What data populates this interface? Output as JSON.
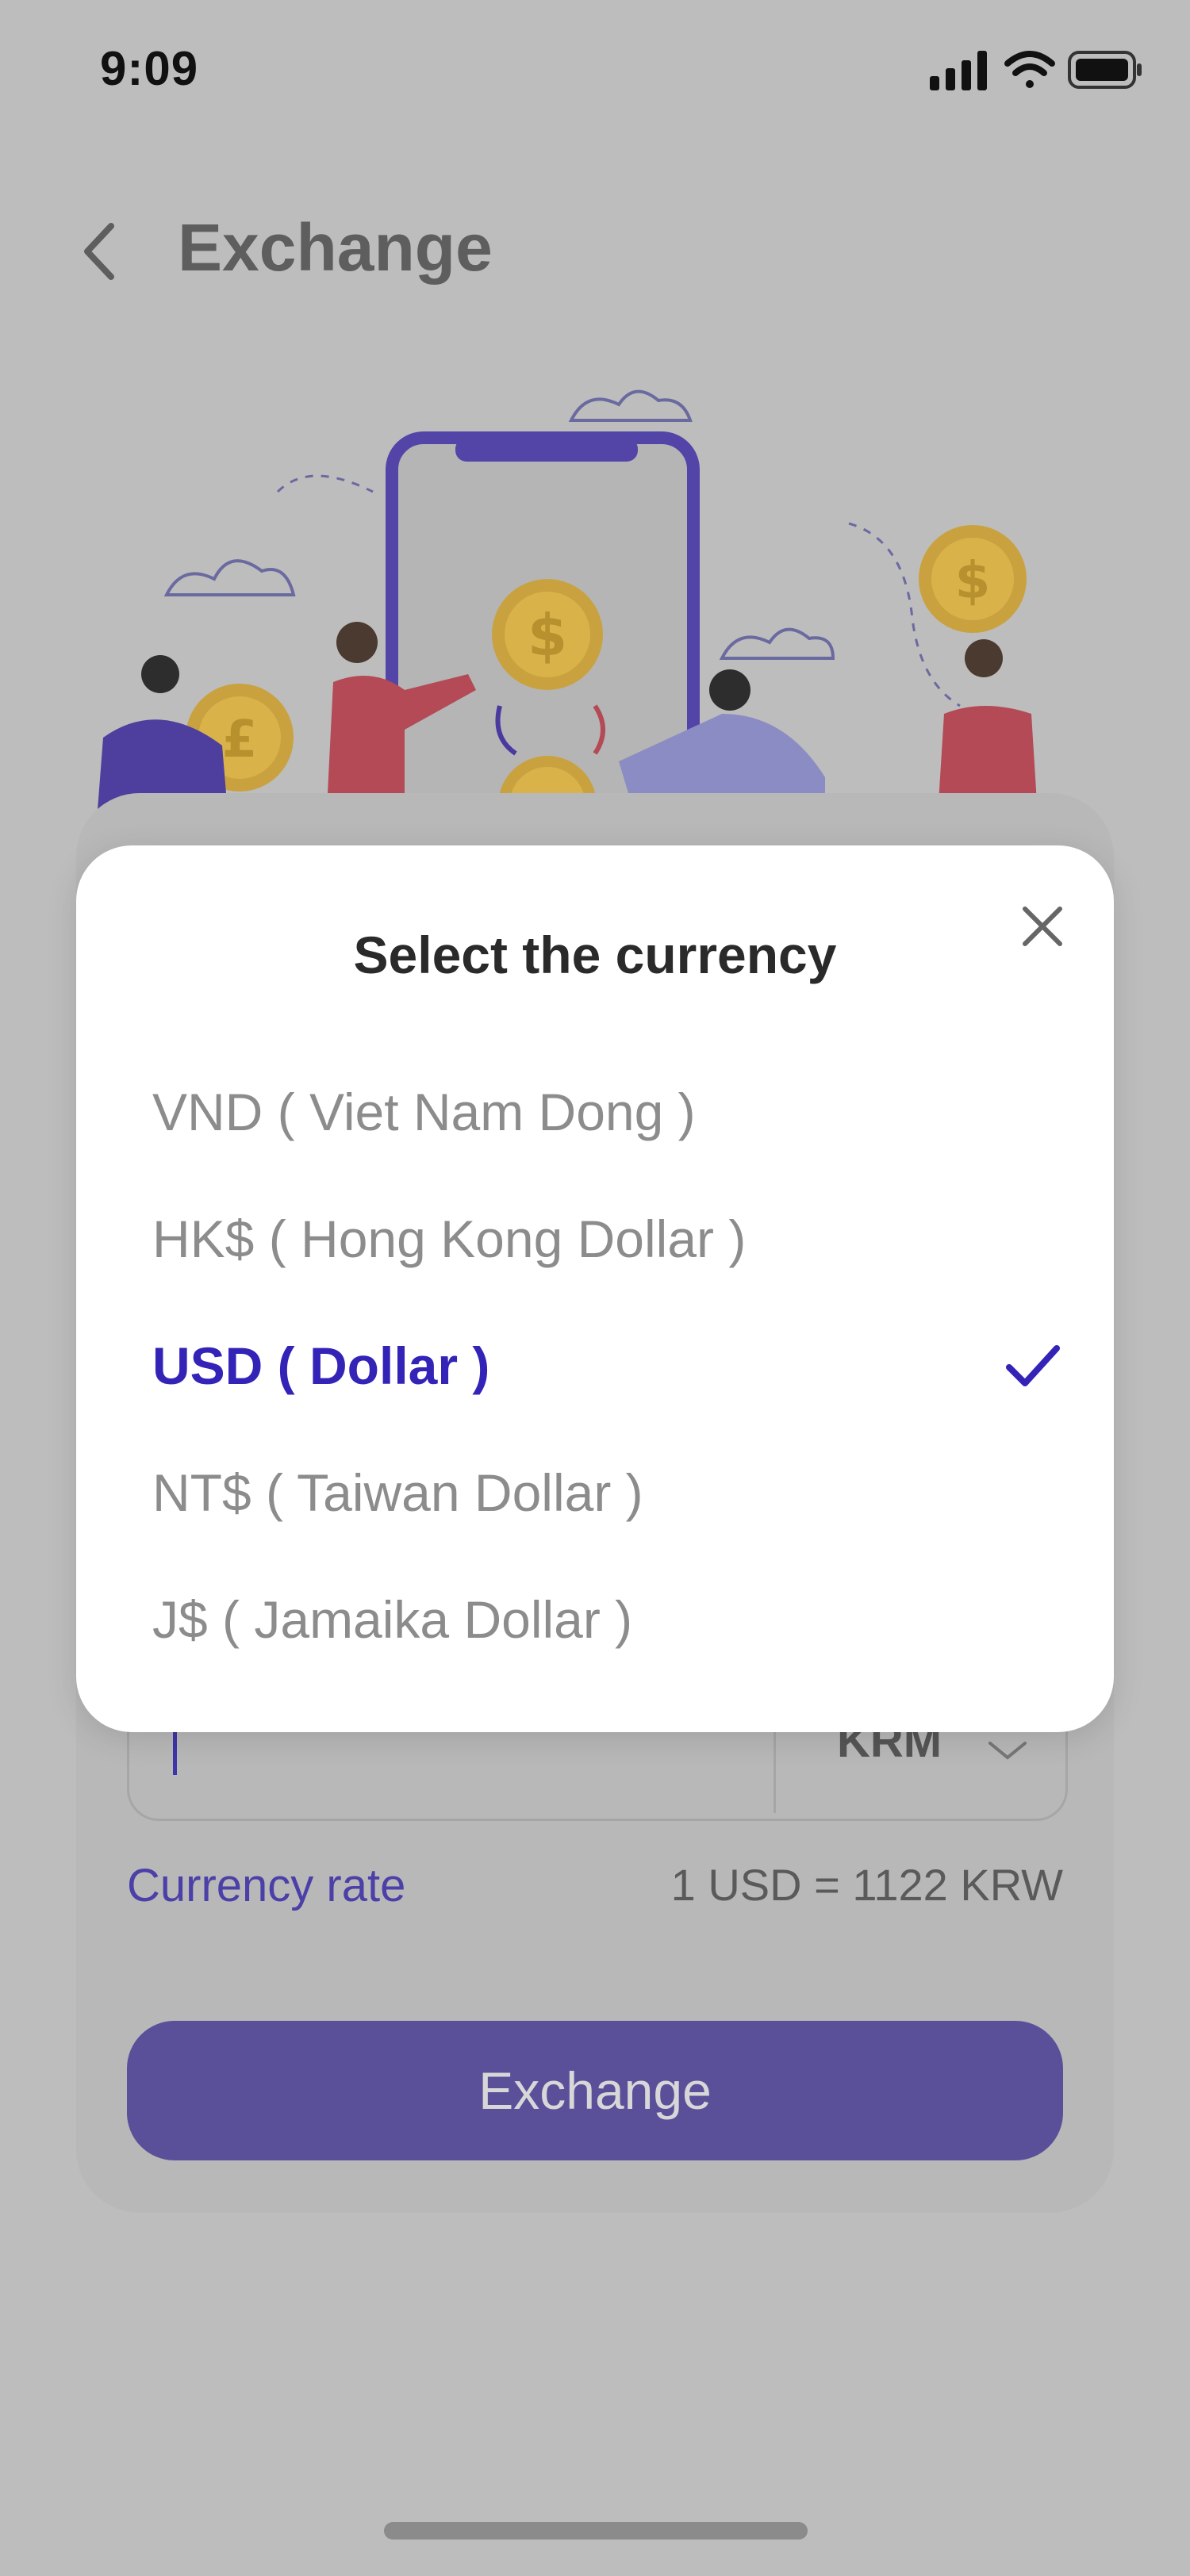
{
  "status_bar": {
    "time": "9:09"
  },
  "header": {
    "title": "Exchange"
  },
  "modal": {
    "title": "Select the currency",
    "options": [
      {
        "label": "VND ( Viet Nam Dong )",
        "selected": false
      },
      {
        "label": "HK$ ( Hong Kong Dollar )",
        "selected": false
      },
      {
        "label": "USD ( Dollar )",
        "selected": true
      },
      {
        "label": "NT$ ( Taiwan Dollar )",
        "selected": false
      },
      {
        "label": "J$ ( Jamaika Dollar )",
        "selected": false
      }
    ]
  },
  "form": {
    "currency": "KRM",
    "rate_label": "Currency rate",
    "rate_value": "1 USD = 1122 KRW",
    "exchange_button": "Exchange"
  },
  "colors": {
    "accent": "#3323b7",
    "button": "#5a509a",
    "overlay": "#bdbdbd"
  }
}
